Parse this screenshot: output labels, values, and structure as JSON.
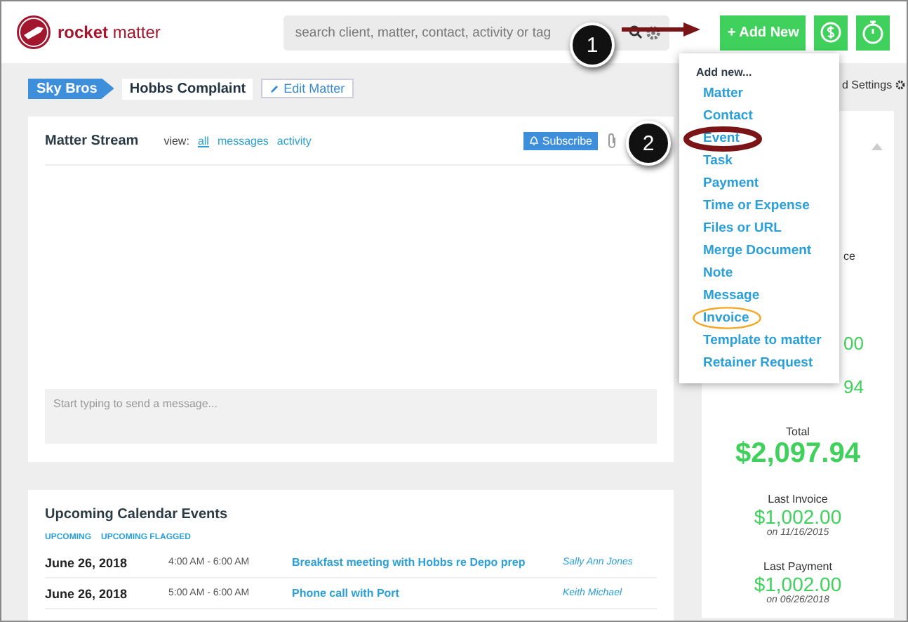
{
  "header": {
    "logo": "**rocket** matter",
    "search": {
      "placeholder": "search client, matter, contact, activity or tag"
    },
    "add_button": "+ Add New"
  },
  "breadcrumb": {
    "client": "Sky Bros",
    "matter": "Hobbs Complaint",
    "edit_button": "Edit Matter",
    "settings_fragment": "d Settings"
  },
  "matter_stream": {
    "title": "Matter Stream",
    "view_label": "view:",
    "views": [
      {
        "label": "all",
        "selected": true
      },
      {
        "label": "messages",
        "selected": false
      },
      {
        "label": "activity",
        "selected": false
      }
    ],
    "subscribe_button": "Subscribe",
    "message_field": {
      "placeholder": "Start typing to send a message..."
    }
  },
  "calendar": {
    "title": "Upcoming Calendar Events",
    "tabs": [
      "UPCOMING",
      "UPCOMING FLAGGED"
    ],
    "events": [
      {
        "date": "June 26, 2018",
        "time": "4:00 AM - 6:00 AM",
        "title": "Breakfast meeting with Hobbs re Depo prep",
        "person": "Sally Ann Jones"
      },
      {
        "date": "June 26, 2018",
        "time": "5:00 AM - 6:00 AM",
        "title": "Phone call with Port",
        "person": "Keith Michael"
      }
    ]
  },
  "billing_panel": {
    "fragments": [
      "ce",
      "00",
      "94"
    ],
    "total_label": "Total",
    "total": "$2,097.94",
    "last_invoice_label": "Last Invoice",
    "last_invoice": "$1,002.00",
    "last_invoice_date": "on 11/16/2015",
    "last_payment_label": "Last Payment",
    "last_payment": "$1,002.00",
    "last_payment_date": "on 06/26/2018"
  },
  "add_menu": {
    "title": "Add new...",
    "items": [
      {
        "label": "Matter",
        "circled": false
      },
      {
        "label": "Contact",
        "circled": false
      },
      {
        "label": "Event",
        "circled": true,
        "color": "#7b1416"
      },
      {
        "label": "Task",
        "circled": false
      },
      {
        "label": "Payment",
        "circled": false
      },
      {
        "label": "Time or Expense",
        "circled": false
      },
      {
        "label": "Files or URL",
        "circled": false
      },
      {
        "label": "Merge Document",
        "circled": false
      },
      {
        "label": "Note",
        "circled": false
      },
      {
        "label": "Message",
        "circled": false
      },
      {
        "label": "Invoice",
        "circled": true,
        "color": "#f5a623"
      },
      {
        "label": "Template to matter",
        "circled": false
      },
      {
        "label": "Retainer Request",
        "circled": false
      }
    ]
  },
  "callouts": [
    "1",
    "2"
  ]
}
